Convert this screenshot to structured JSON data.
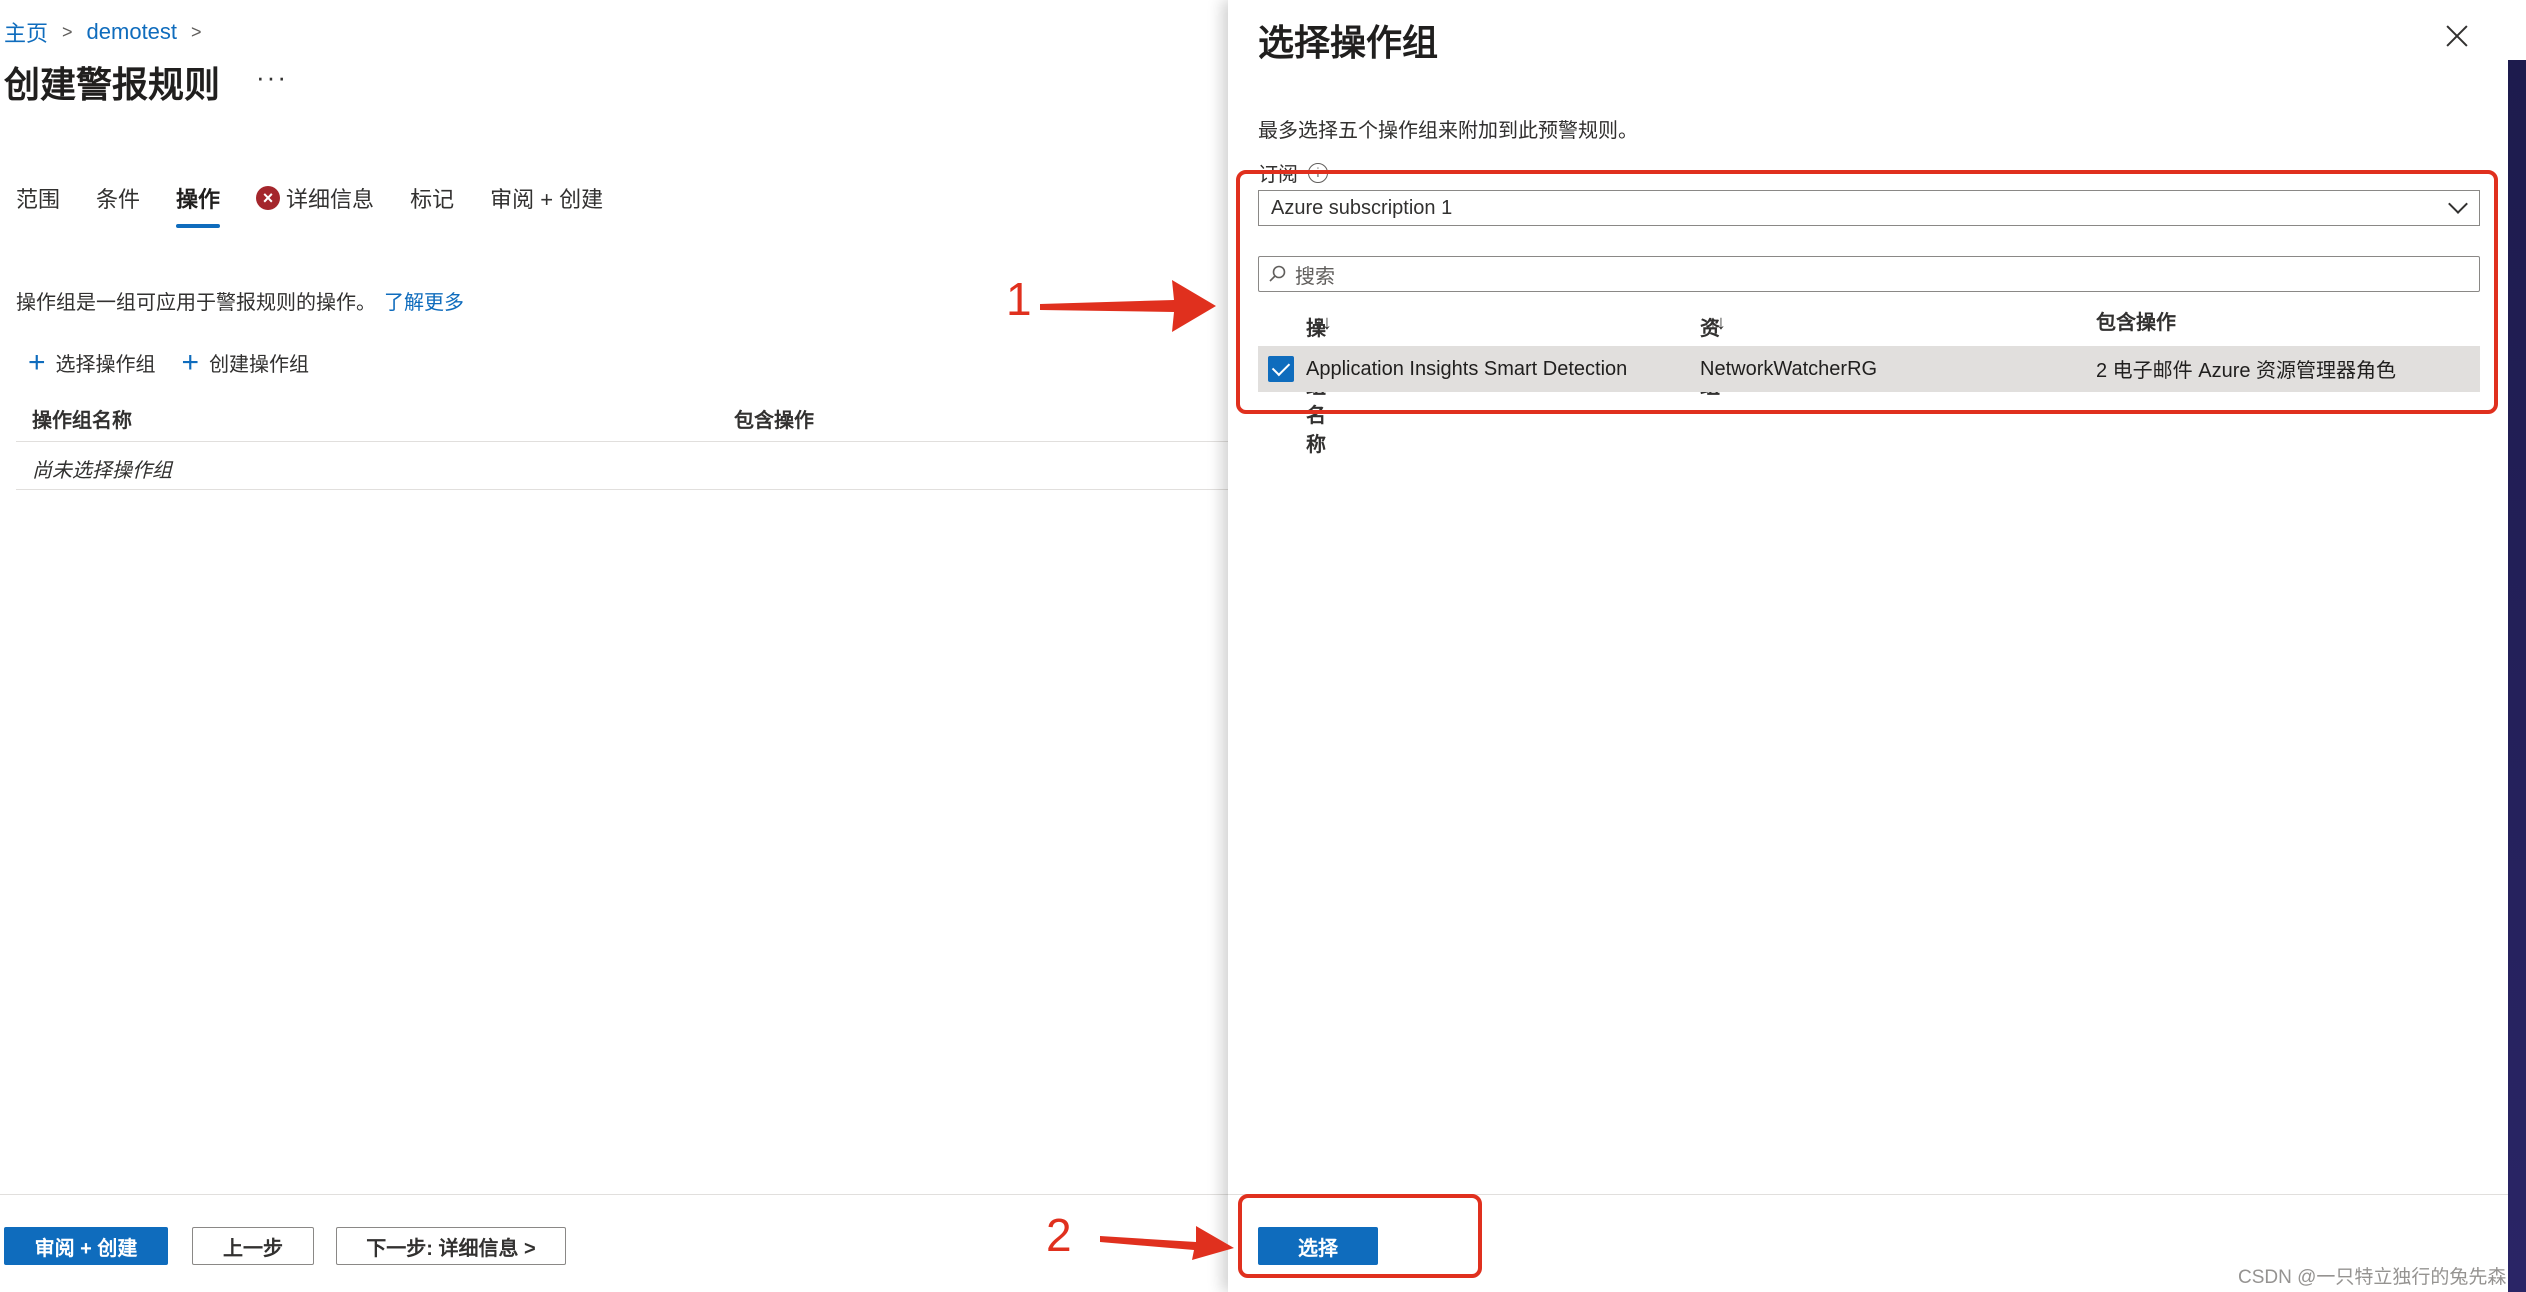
{
  "breadcrumb": {
    "home": "主页",
    "resource": "demotest"
  },
  "page": {
    "title": "创建警报规则",
    "more": "···",
    "tabs": {
      "scope": "范围",
      "condition": "条件",
      "actions": "操作",
      "details": "详细信息",
      "tags": "标记",
      "review": "审阅 + 创建"
    },
    "description": "操作组是一组可应用于警报规则的操作。",
    "learn_more": "了解更多",
    "select_group": "选择操作组",
    "create_group": "创建操作组",
    "table_headers": {
      "name": "操作组名称",
      "contains": "包含操作"
    },
    "empty_text": "尚未选择操作组",
    "footer": {
      "review_create": "审阅 + 创建",
      "previous": "上一步",
      "next": "下一步: 详细信息 >"
    }
  },
  "panel": {
    "title": "选择操作组",
    "description": "最多选择五个操作组来附加到此预警规则。",
    "subscription_label": "订阅",
    "subscription_value": "Azure subscription 1",
    "search_placeholder": "搜索",
    "headers": {
      "name": "操作组名称",
      "resource_group": "资源组",
      "contains": "包含操作"
    },
    "sort_icon": "↑↓",
    "rows": [
      {
        "name": "Application Insights Smart Detection",
        "resource_group": "NetworkWatcherRG",
        "contains": "2 电子邮件 Azure 资源管理器角色",
        "checked": true
      }
    ],
    "select_button": "选择"
  },
  "annotations": {
    "one": "1",
    "two": "2",
    "color": "#e0301e"
  },
  "watermark": "CSDN @一只特立独行的兔先森",
  "colors": {
    "accent": "#0f6cbd",
    "error": "#a4262c",
    "row_selected": "#e1dfdd"
  }
}
